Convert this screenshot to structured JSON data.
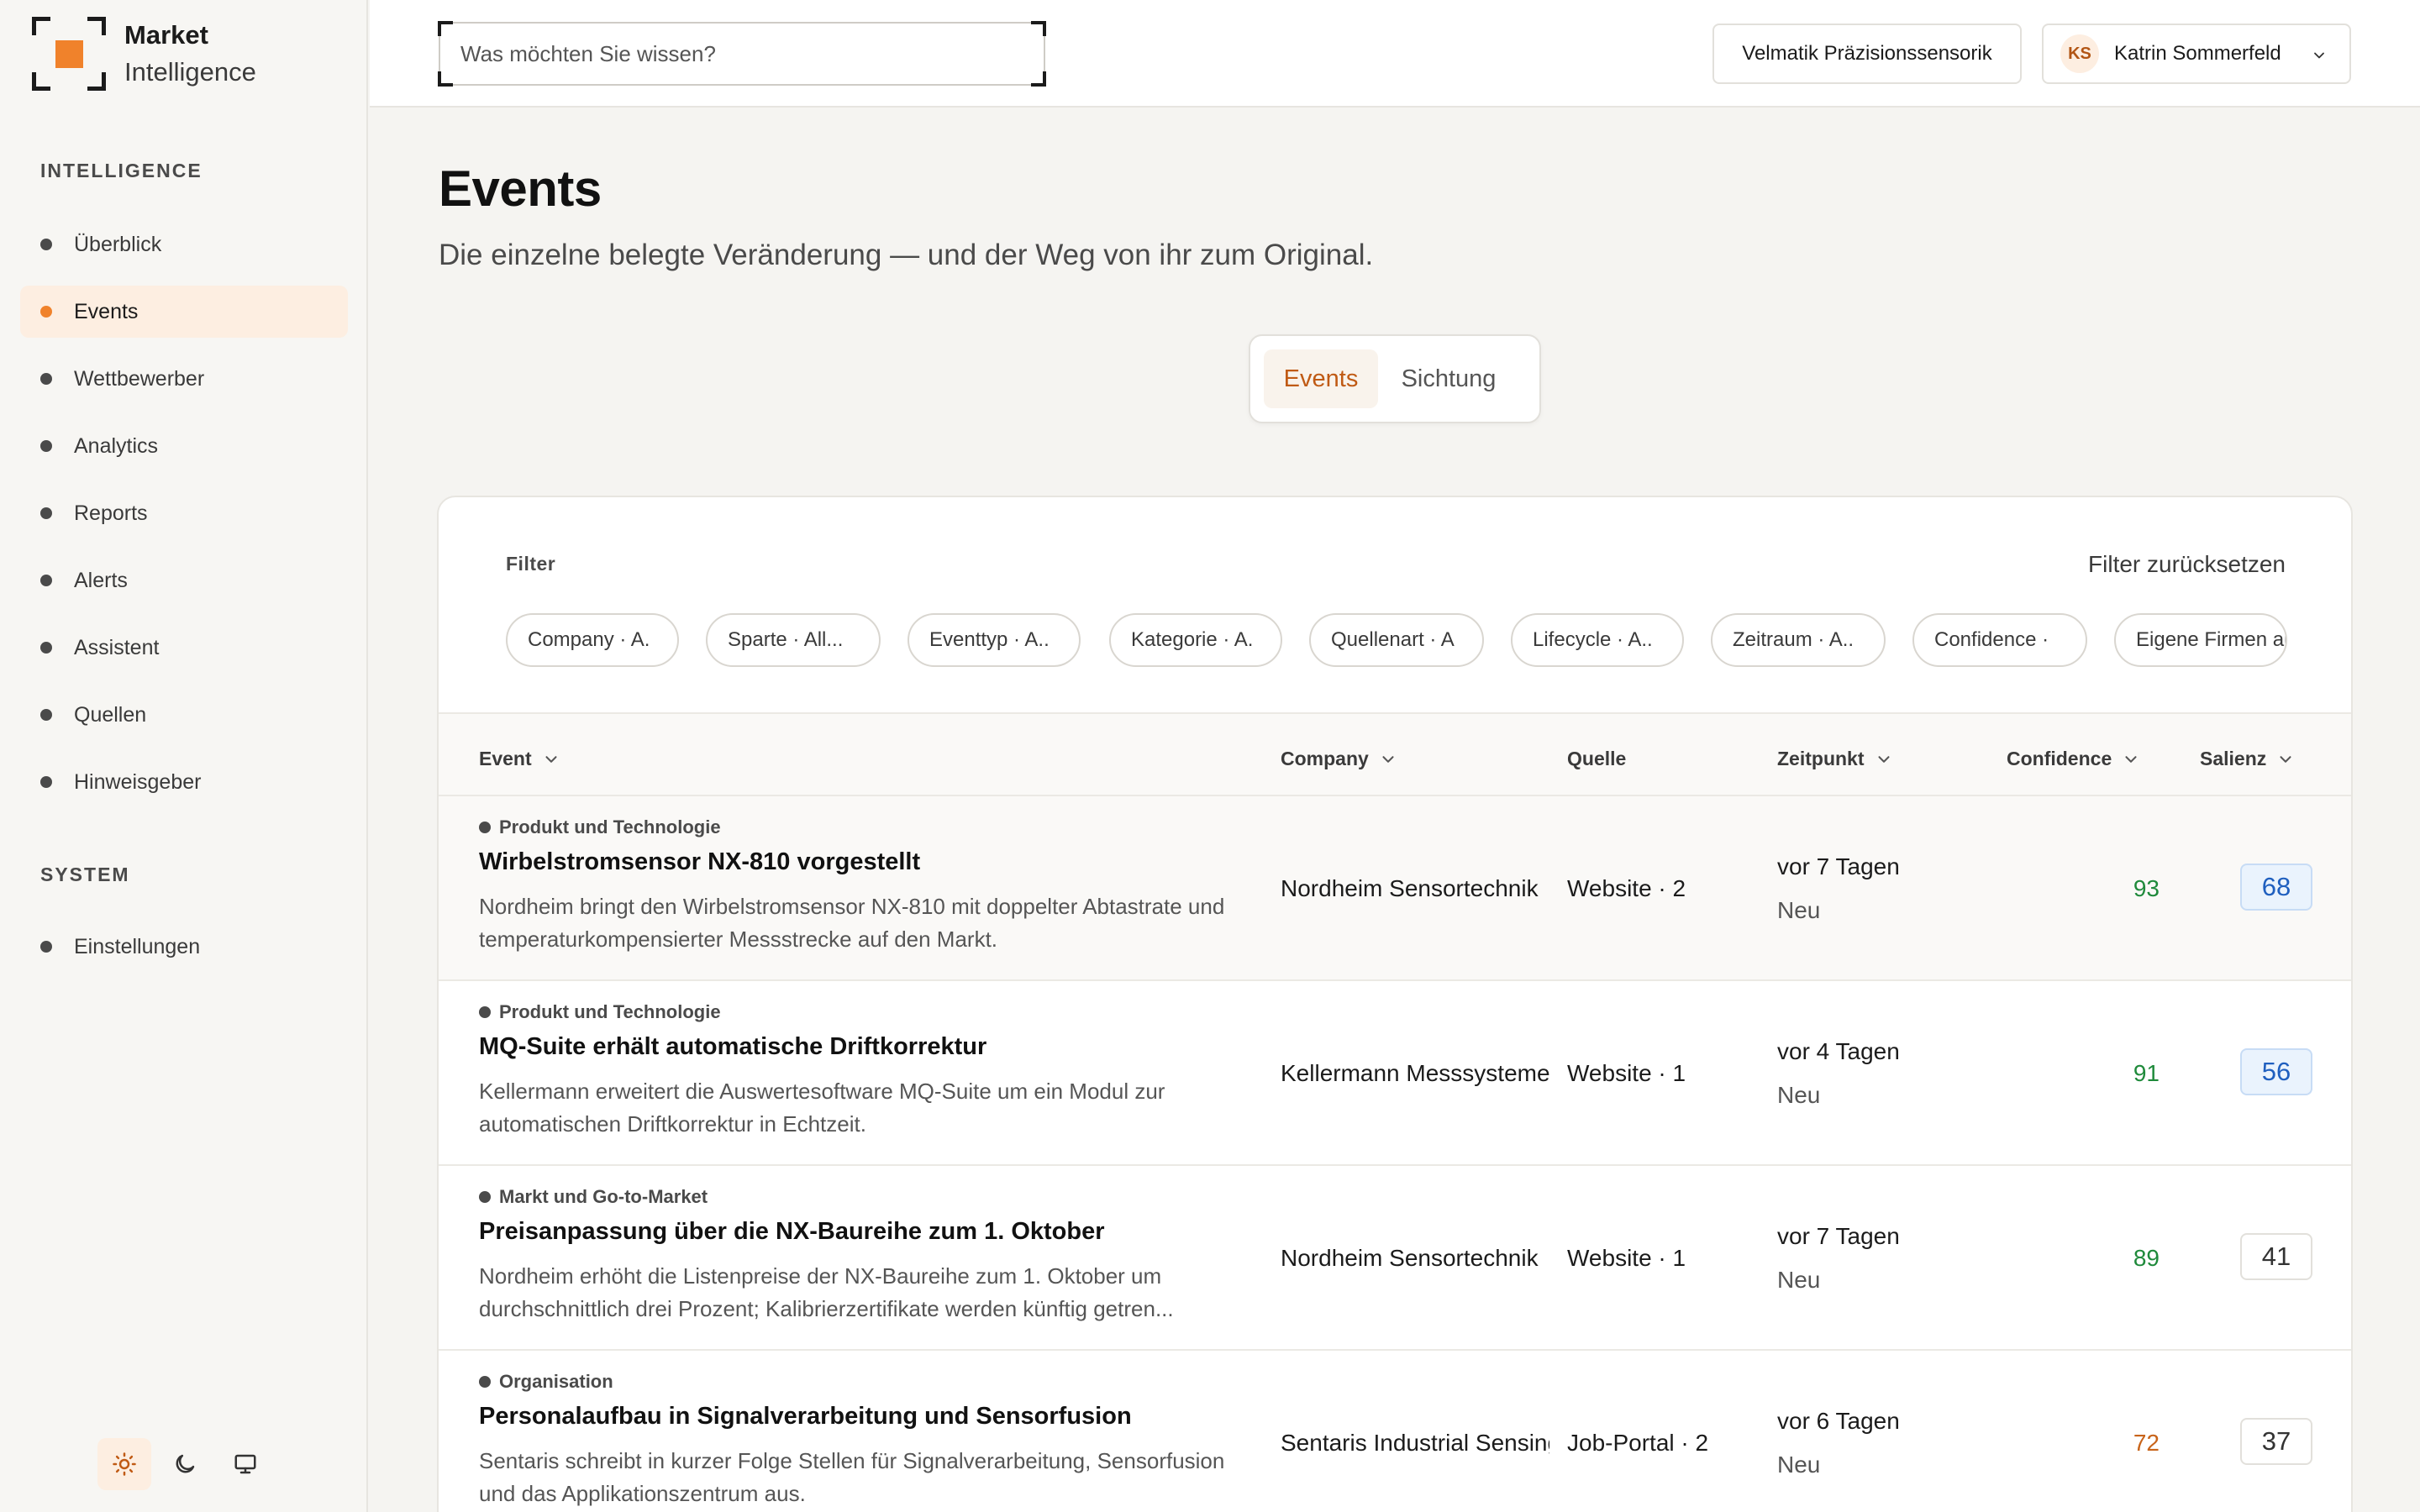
{
  "app": {
    "name_line1": "Market",
    "name_line2": "Intelligence"
  },
  "sidebar": {
    "section_intelligence": "INTELLIGENCE",
    "section_system": "SYSTEM",
    "items": [
      {
        "label": "Überblick"
      },
      {
        "label": "Events",
        "active": true
      },
      {
        "label": "Wettbewerber"
      },
      {
        "label": "Analytics"
      },
      {
        "label": "Reports"
      },
      {
        "label": "Alerts"
      },
      {
        "label": "Assistent"
      },
      {
        "label": "Quellen"
      },
      {
        "label": "Hinweisgeber"
      }
    ],
    "system_items": [
      {
        "label": "Einstellungen"
      }
    ],
    "theme": {
      "options": [
        "sun-icon",
        "moon-icon",
        "monitor-icon"
      ],
      "active": "sun-icon"
    }
  },
  "topbar": {
    "search_placeholder": "Was möchten Sie wissen?",
    "org": "Velmatik Präzisionssensorik",
    "user": {
      "initials": "KS",
      "name": "Katrin Sommerfeld"
    }
  },
  "page": {
    "title": "Events",
    "subtitle": "Die einzelne belegte Veränderung — und der Weg von ihr zum Original."
  },
  "tabs": [
    {
      "label": "Events",
      "active": true
    },
    {
      "label": "Sichtung"
    }
  ],
  "filters": {
    "label": "Filter",
    "reset": "Filter zurücksetzen",
    "chips": [
      "Company · A.",
      "Sparte · All...",
      "Eventtyp · A..",
      "Kategorie · A.",
      "Quellenart · A",
      "Lifecycle · A..",
      "Zeitraum · A..",
      "Confidence ·",
      "Eigene Firmen ausblenden ·"
    ]
  },
  "table": {
    "columns": {
      "event": "Event",
      "company": "Company",
      "source": "Quelle",
      "time": "Zeitpunkt",
      "confidence": "Confidence",
      "salience": "Salienz"
    },
    "rows": [
      {
        "category": "Produkt und Technologie",
        "title": "Wirbelstromsensor NX-810 vorgestellt",
        "description": "Nordheim bringt den Wirbelstromsensor NX-810 mit doppelter Abtastrate und temperaturkompensierter Messstrecke auf den Markt.",
        "company": "Nordheim Sensortechnik",
        "source": "Website · 2",
        "time": "vor 7 Tagen",
        "status": "Neu",
        "confidence": "93",
        "salience": "68"
      },
      {
        "category": "Produkt und Technologie",
        "title": "MQ-Suite erhält automatische Driftkorrektur",
        "description": "Kellermann erweitert die Auswertesoftware MQ-Suite um ein Modul zur automatischen Driftkorrektur in Echtzeit.",
        "company": "Kellermann Messsysteme",
        "source": "Website · 1",
        "time": "vor 4 Tagen",
        "status": "Neu",
        "confidence": "91",
        "salience": "56"
      },
      {
        "category": "Markt und Go-to-Market",
        "title": "Preisanpassung über die NX-Baureihe zum 1. Oktober",
        "description": "Nordheim erhöht die Listenpreise der NX-Baureihe zum 1. Oktober um durchschnittlich drei Prozent; Kalibrierzertifikate werden künftig getren...",
        "company": "Nordheim Sensortechnik",
        "source": "Website · 1",
        "time": "vor 7 Tagen",
        "status": "Neu",
        "confidence": "89",
        "salience": "41"
      },
      {
        "category": "Organisation",
        "title": "Personalaufbau in Signalverarbeitung und Sensorfusion",
        "description": "Sentaris schreibt in kurzer Folge Stellen für Signalverarbeitung, Sensorfusion und das Applikationszentrum aus.",
        "company": "Sentaris Industrial Sensing",
        "source": "Job-Portal · 2",
        "time": "vor 6 Tagen",
        "status": "Neu",
        "confidence": "72",
        "salience": "37"
      }
    ]
  },
  "colors": {
    "accent": "#f0822b",
    "accent_text": "#c05a14",
    "confidence_high": "#1f8a3b",
    "confidence_mid": "#c8641a",
    "salience_high": "#1f5fbf"
  }
}
